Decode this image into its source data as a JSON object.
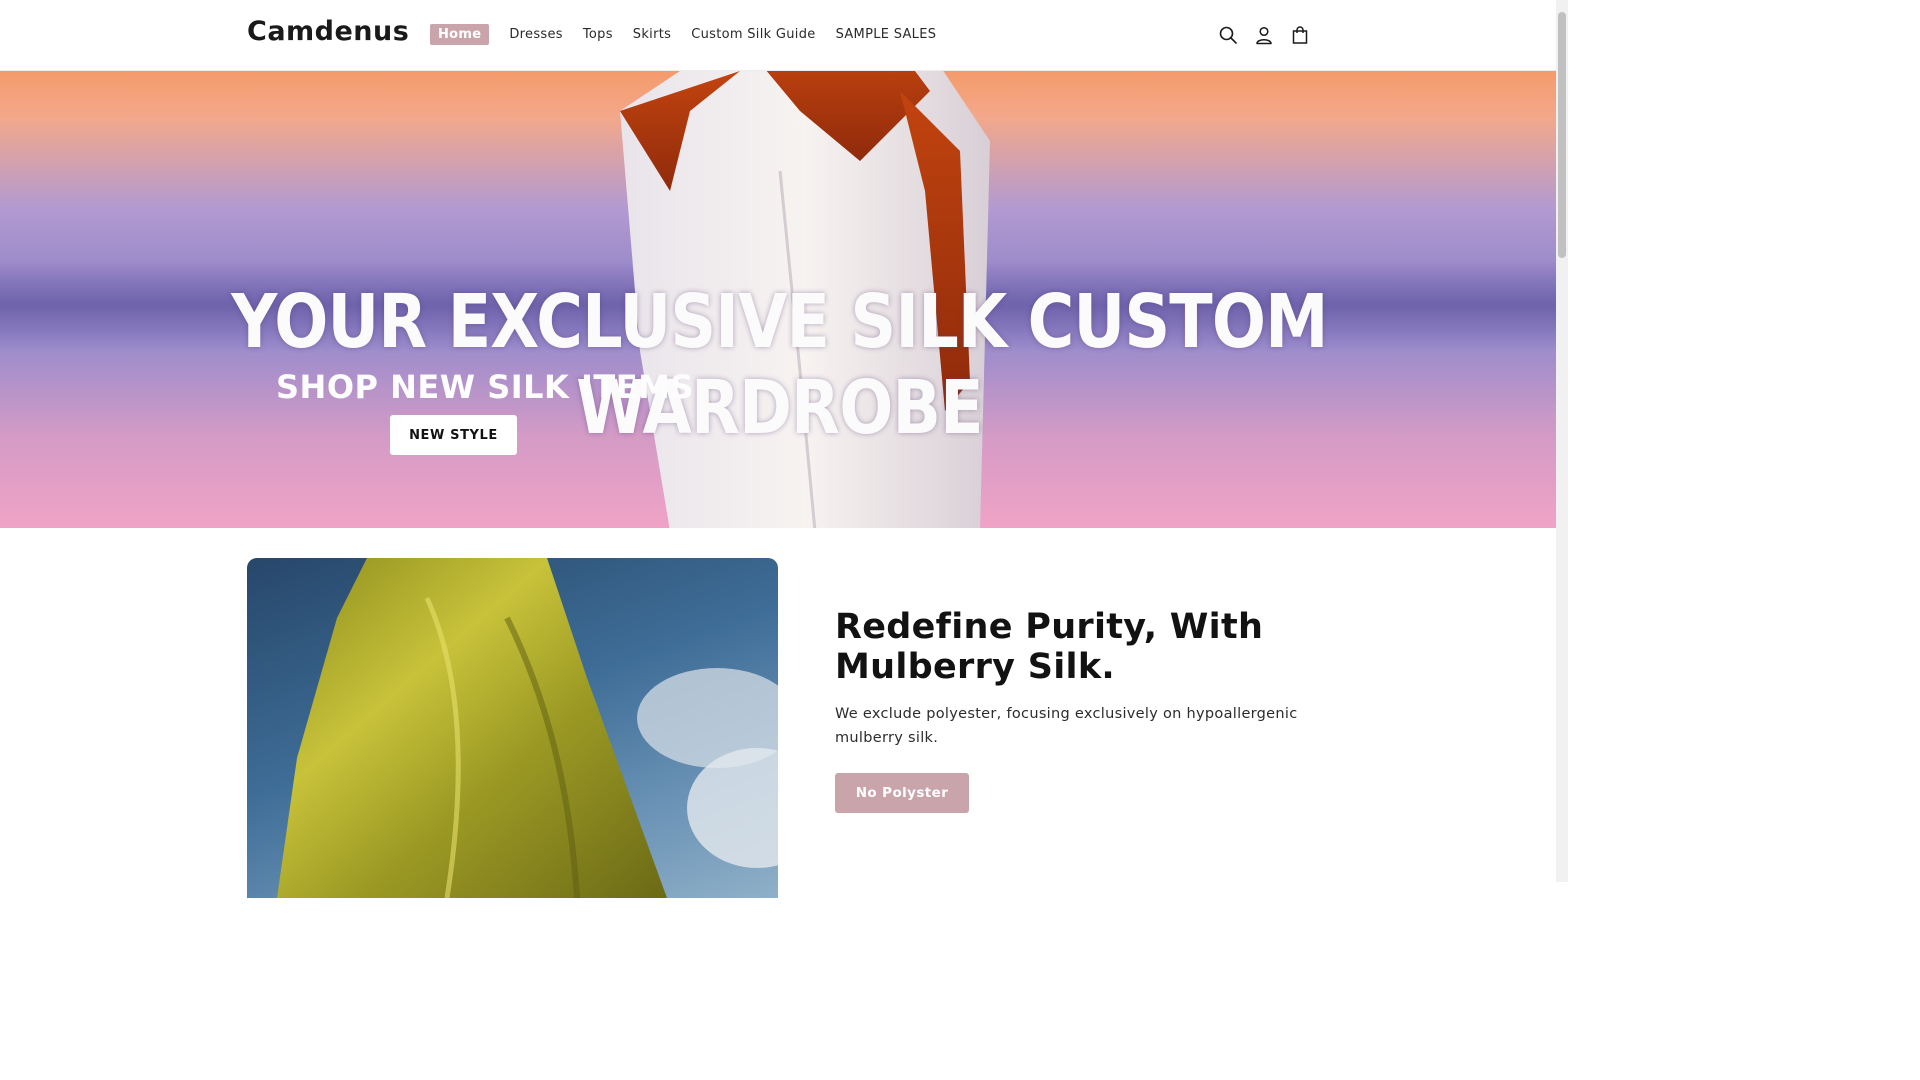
{
  "header": {
    "logo": "Camdenus",
    "nav": [
      {
        "label": "Home",
        "active": true
      },
      {
        "label": "Dresses"
      },
      {
        "label": "Tops"
      },
      {
        "label": "Skirts"
      },
      {
        "label": "Custom Silk Guide"
      },
      {
        "label": "SAMPLE SALES"
      }
    ],
    "icons": [
      "search-icon",
      "account-icon",
      "cart-icon"
    ]
  },
  "hero": {
    "headline": "YOUR EXCLUSIVE SILK CUSTOM WARDROBE",
    "subheading": "SHOP NEW SILK ITEMS",
    "button_label": "NEW STYLE"
  },
  "feature": {
    "title": "Redefine Purity, With Mulberry Silk.",
    "text": "We exclude polyester, focusing exclusively on hypoallergenic mulberry silk.",
    "button_label": "No Polyster"
  },
  "colors": {
    "accent": "#c9a4ab",
    "text": "#121212"
  }
}
